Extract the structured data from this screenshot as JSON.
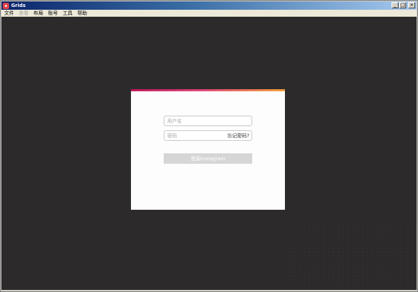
{
  "window": {
    "title": "Grids",
    "controls": {
      "minimize": "_",
      "maximize": "□",
      "close": "×"
    }
  },
  "menu": {
    "items": [
      {
        "label": "文件",
        "enabled": true
      },
      {
        "label": "查看",
        "enabled": false
      },
      {
        "label": "布局",
        "enabled": true
      },
      {
        "label": "账号",
        "enabled": true
      },
      {
        "label": "工具",
        "enabled": true
      },
      {
        "label": "帮助",
        "enabled": true
      }
    ]
  },
  "login": {
    "username_placeholder": "用户名",
    "password_placeholder": "密码",
    "forgot_label": "忘记密码?",
    "submit_label": "登录Instagram"
  },
  "colors": {
    "background": "#2c2a2b",
    "card": "#fdfdfd",
    "accent_start": "#c2185b",
    "accent_end": "#f4a13a",
    "button_disabled": "#d6d6d6"
  }
}
